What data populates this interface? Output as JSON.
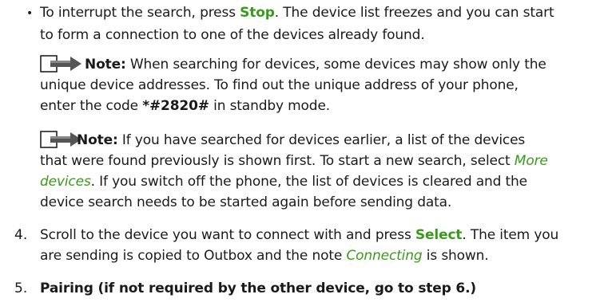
{
  "bullet_item": {
    "bullet": "•",
    "l1_a": "To interrupt the search, press ",
    "l1_stop": "Stop",
    "l1_b": ". The device list freezes and you can start",
    "l2": "to form a connection to one of the devices already found."
  },
  "note1": {
    "label": "Note:",
    "l1_rest": " When searching for devices, some devices may show only the",
    "l2": "unique device addresses. To find out the unique address of your phone,",
    "l3_a": "enter the code ",
    "l3_code": "*#2820#",
    "l3_b": " in standby mode."
  },
  "note2": {
    "label": "Note:",
    "l1_rest": " If you have searched for devices earlier, a list of the devices",
    "l2_a": "that were found previously is shown first. To start a new search, select ",
    "l2_more": "More",
    "l3_devices": "devices",
    "l3_b": ". If you switch off the phone, the list of devices is cleared and the",
    "l4": "device search needs to be started again before sending data."
  },
  "step4": {
    "num": "4.",
    "l1_a": "Scroll to the device you want to connect with and press ",
    "l1_select": "Select",
    "l1_b": ". The item you",
    "l2_a": "are sending is copied to Outbox and the note ",
    "l2_connecting": "Connecting",
    "l2_b": " is shown."
  },
  "step5": {
    "num": "5.",
    "heading": "Pairing (if not required by the other device, go to step 6.)"
  }
}
